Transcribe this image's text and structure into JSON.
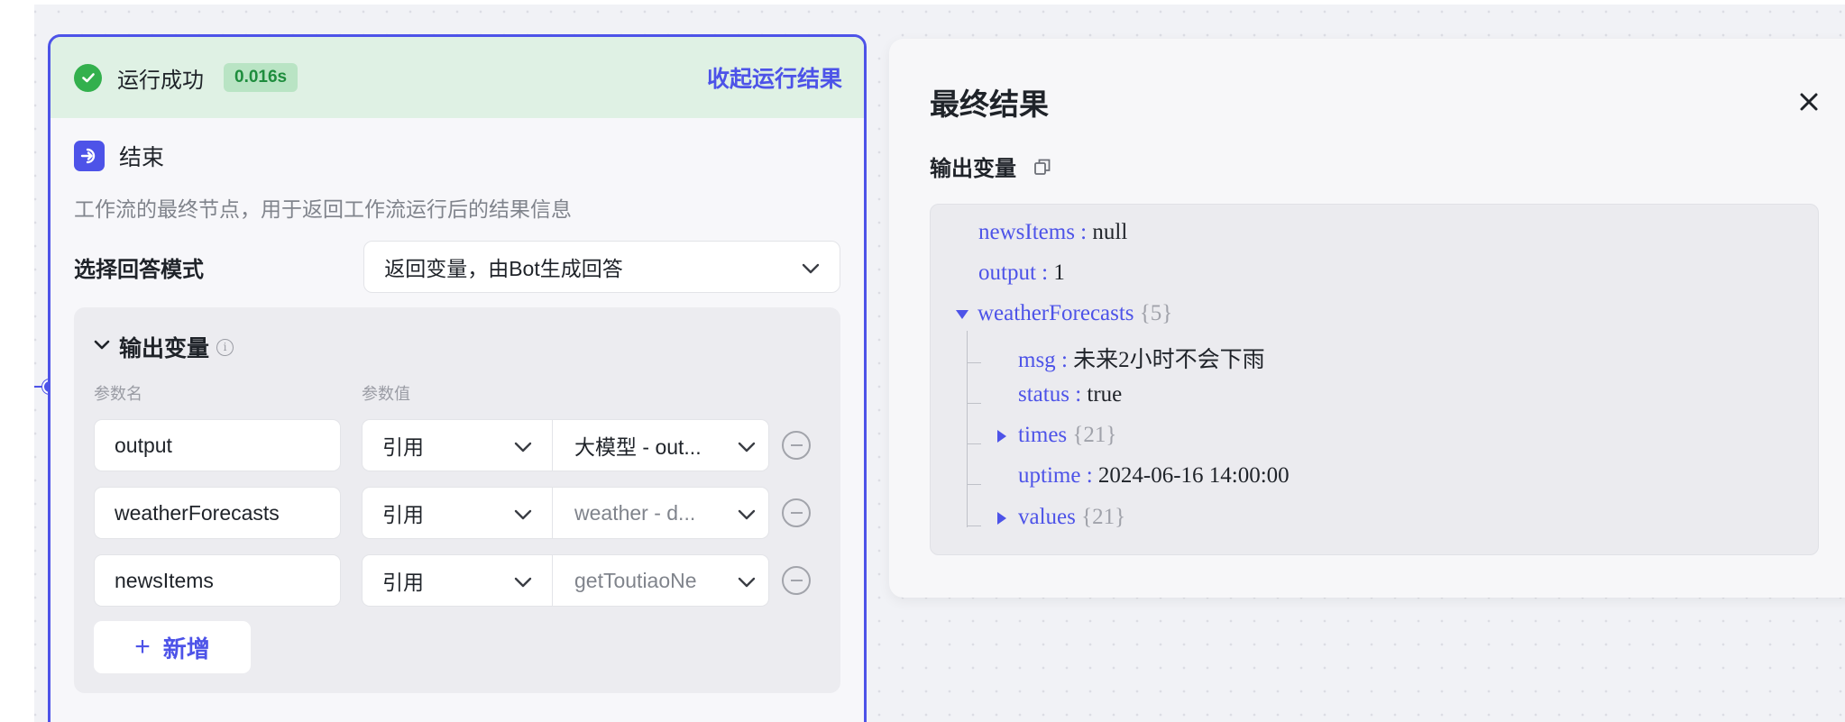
{
  "node": {
    "run_status": "运行成功",
    "run_time": "0.016s",
    "collapse_label": "收起运行结果",
    "title": "结束",
    "description": "工作流的最终节点，用于返回工作流运行后的结果信息",
    "mode_label": "选择回答模式",
    "mode_value": "返回变量，由Bot生成回答",
    "outputs_title": "输出变量",
    "col_name": "参数名",
    "col_value": "参数值",
    "params": [
      {
        "name": "output",
        "ref": "引用",
        "value": "大模型 - out..."
      },
      {
        "name": "weatherForecasts",
        "ref": "引用",
        "value": "weather - d..."
      },
      {
        "name": "newsItems",
        "ref": "引用",
        "value": "getToutiaoNe"
      }
    ],
    "add_label": "新增"
  },
  "result": {
    "title": "最终结果",
    "output_label": "输出变量",
    "lines": {
      "news_key": "newsItems",
      "news_val": "null",
      "output_key": "output",
      "output_val": "1",
      "wf_key": "weatherForecasts",
      "wf_count": "{5}",
      "msg_key": "msg",
      "msg_val": "未来2小时不会下雨",
      "status_key": "status",
      "status_val": "true",
      "times_key": "times",
      "times_count": "{21}",
      "uptime_key": "uptime",
      "uptime_val": "2024-06-16 14:00:00",
      "values_key": "values",
      "values_count": "{21}",
      "sep": " : "
    }
  },
  "colors": {
    "accent": "#4d53e8",
    "success": "#33b04d",
    "success_bg": "#dff1e4"
  },
  "icons": [
    "check-circle-icon",
    "end-node-icon",
    "chevron-down-icon",
    "info-icon",
    "minus-circle-icon",
    "plus-icon",
    "close-icon",
    "copy-icon",
    "triangle-down-icon",
    "triangle-right-icon"
  ]
}
